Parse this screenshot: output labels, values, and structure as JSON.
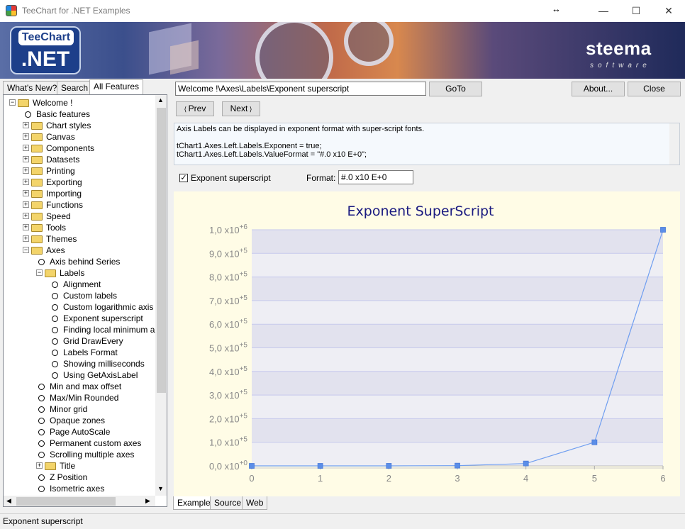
{
  "window": {
    "title": "TeeChart for .NET Examples",
    "minimize": "—",
    "maximize": "☐",
    "close": "✕",
    "resize_icon": "↔"
  },
  "banner": {
    "logo_top": "TeeChart",
    "logo_bottom": ".NET",
    "brand": "steema",
    "brand_sub": "software"
  },
  "left_tabs": [
    {
      "label": "What's New?"
    },
    {
      "label": "Search"
    },
    {
      "label": "All Features"
    }
  ],
  "tree": [
    {
      "label": "Welcome !",
      "depth": 0,
      "kind": "folder",
      "expander": "−"
    },
    {
      "label": "Basic features",
      "depth": 1,
      "kind": "leaf"
    },
    {
      "label": "Chart styles",
      "depth": 1,
      "kind": "folder",
      "expander": "+"
    },
    {
      "label": "Canvas",
      "depth": 1,
      "kind": "folder",
      "expander": "+"
    },
    {
      "label": "Components",
      "depth": 1,
      "kind": "folder",
      "expander": "+"
    },
    {
      "label": "Datasets",
      "depth": 1,
      "kind": "folder",
      "expander": "+"
    },
    {
      "label": "Printing",
      "depth": 1,
      "kind": "folder",
      "expander": "+"
    },
    {
      "label": "Exporting",
      "depth": 1,
      "kind": "folder",
      "expander": "+"
    },
    {
      "label": "Importing",
      "depth": 1,
      "kind": "folder",
      "expander": "+"
    },
    {
      "label": "Functions",
      "depth": 1,
      "kind": "folder",
      "expander": "+"
    },
    {
      "label": "Speed",
      "depth": 1,
      "kind": "folder",
      "expander": "+"
    },
    {
      "label": "Tools",
      "depth": 1,
      "kind": "folder",
      "expander": "+"
    },
    {
      "label": "Themes",
      "depth": 1,
      "kind": "folder",
      "expander": "+"
    },
    {
      "label": "Axes",
      "depth": 1,
      "kind": "folder",
      "expander": "−"
    },
    {
      "label": "Axis behind Series",
      "depth": 2,
      "kind": "leaf"
    },
    {
      "label": "Labels",
      "depth": 2,
      "kind": "folder",
      "expander": "−"
    },
    {
      "label": "Alignment",
      "depth": 3,
      "kind": "leaf"
    },
    {
      "label": "Custom labels",
      "depth": 3,
      "kind": "leaf"
    },
    {
      "label": "Custom logarithmic axis",
      "depth": 3,
      "kind": "leaf"
    },
    {
      "label": "Exponent superscript",
      "depth": 3,
      "kind": "leaf"
    },
    {
      "label": "Finding local minimum and",
      "depth": 3,
      "kind": "leaf"
    },
    {
      "label": "Grid DrawEvery",
      "depth": 3,
      "kind": "leaf"
    },
    {
      "label": "Labels Format",
      "depth": 3,
      "kind": "leaf"
    },
    {
      "label": "Showing milliseconds",
      "depth": 3,
      "kind": "leaf"
    },
    {
      "label": "Using GetAxisLabel",
      "depth": 3,
      "kind": "leaf"
    },
    {
      "label": "Min and max offset",
      "depth": 2,
      "kind": "leaf"
    },
    {
      "label": "Max/Min Rounded",
      "depth": 2,
      "kind": "leaf"
    },
    {
      "label": "Minor grid",
      "depth": 2,
      "kind": "leaf"
    },
    {
      "label": "Opaque zones",
      "depth": 2,
      "kind": "leaf"
    },
    {
      "label": "Page AutoScale",
      "depth": 2,
      "kind": "leaf"
    },
    {
      "label": "Permanent custom axes",
      "depth": 2,
      "kind": "leaf"
    },
    {
      "label": "Scrolling multiple axes",
      "depth": 2,
      "kind": "leaf"
    },
    {
      "label": "Title",
      "depth": 2,
      "kind": "folder",
      "expander": "+"
    },
    {
      "label": "Z Position",
      "depth": 2,
      "kind": "leaf"
    },
    {
      "label": "Isometric axes",
      "depth": 2,
      "kind": "leaf"
    }
  ],
  "toolbar": {
    "path_value": "Welcome !\\Axes\\Labels\\Exponent superscript",
    "goto": "GoTo",
    "about": "About...",
    "close": "Close",
    "prev": "Prev",
    "next": "Next"
  },
  "description": [
    "Axis Labels can be displayed in exponent format with super-script fonts.",
    "",
    "tChart1.Axes.Left.Labels.Exponent = true;",
    "tChart1.Axes.Left.Labels.ValueFormat = \"#.0 x10 E+0\";"
  ],
  "options": {
    "checkbox_label": "Exponent superscript",
    "checkbox_checked": true,
    "format_label": "Format:",
    "format_value": "#.0 x10 E+0"
  },
  "bottom_tabs": [
    {
      "label": "Example"
    },
    {
      "label": "Source"
    },
    {
      "label": "Web"
    }
  ],
  "status": "Exponent superscript",
  "chart_data": {
    "type": "line",
    "title": "Exponent SuperScript",
    "x": [
      0,
      1,
      2,
      3,
      4,
      5,
      6
    ],
    "values": [
      1,
      10,
      100,
      1000,
      10000,
      100000,
      1000000
    ],
    "xlim": [
      0,
      6
    ],
    "ylim": [
      0,
      1000000
    ],
    "x_ticks": [
      "0",
      "1",
      "2",
      "3",
      "4",
      "5",
      "6"
    ],
    "y_ticks": [
      {
        "mantissa": "0,0 x10",
        "exp": "+0"
      },
      {
        "mantissa": "1,0 x10",
        "exp": "+5"
      },
      {
        "mantissa": "2,0 x10",
        "exp": "+5"
      },
      {
        "mantissa": "3,0 x10",
        "exp": "+5"
      },
      {
        "mantissa": "4,0 x10",
        "exp": "+5"
      },
      {
        "mantissa": "5,0 x10",
        "exp": "+5"
      },
      {
        "mantissa": "6,0 x10",
        "exp": "+5"
      },
      {
        "mantissa": "7,0 x10",
        "exp": "+5"
      },
      {
        "mantissa": "8,0 x10",
        "exp": "+5"
      },
      {
        "mantissa": "9,0 x10",
        "exp": "+5"
      },
      {
        "mantissa": "1,0 x10",
        "exp": "+6"
      }
    ],
    "grid": true,
    "colors": {
      "line": "#6f9ef0",
      "marker": "#5b8ee8",
      "title": "#1a1a80",
      "band_dark": "#e2e2ee",
      "band_light": "#eeeef4"
    }
  }
}
